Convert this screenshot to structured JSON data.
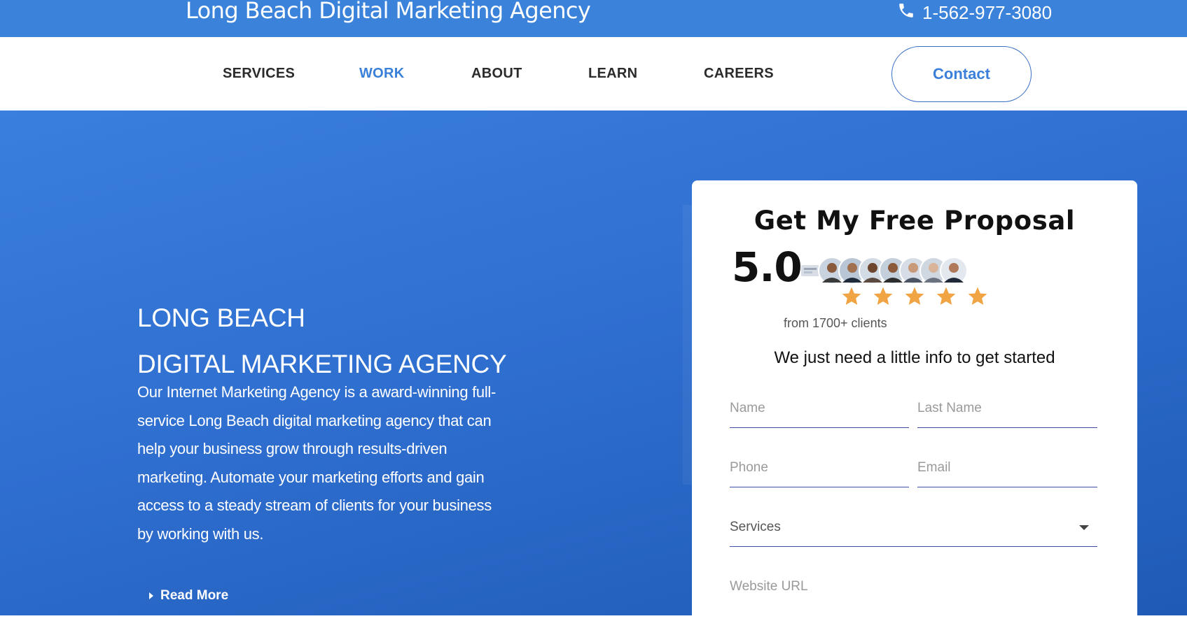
{
  "header": {
    "brand": "Long Beach Digital Marketing Agency",
    "phone": "1-562-977-3080"
  },
  "nav": {
    "items": [
      {
        "label": "SERVICES"
      },
      {
        "label": "WORK"
      },
      {
        "label": "ABOUT"
      },
      {
        "label": "LEARN"
      },
      {
        "label": "CAREERS"
      }
    ],
    "active": "WORK",
    "contact_label": "Contact"
  },
  "hero": {
    "title_line1": "LONG BEACH",
    "title_line2": "DIGITAL MARKETING AGENCY",
    "description": "Our Internet Marketing Agency is a award-winning full-service Long Beach digital marketing agency that can help your business grow through results-driven marketing. Automate your marketing efforts and gain access to a steady stream of clients for your business by working with us.",
    "read_more": "Read More"
  },
  "form": {
    "title": "Get My Free Proposal",
    "rating": "5.0",
    "stars": 5,
    "clients_text": "from 1700+ clients",
    "subtitle": "We just need a little info to get started",
    "fields": {
      "name": "Name",
      "last_name": "Last Name",
      "phone": "Phone",
      "email": "Email",
      "services": "Services",
      "website": "Website URL"
    }
  },
  "colors": {
    "brand_blue": "#3b82db",
    "nav_active": "#3a7fd9",
    "star": "#f0a443",
    "field_line": "#3f4fa8"
  }
}
